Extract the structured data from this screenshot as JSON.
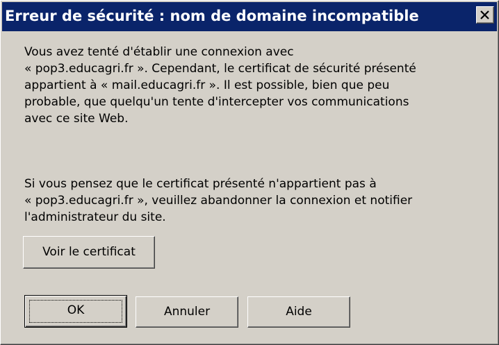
{
  "window": {
    "title": "Erreur de sécurité : nom de domaine incompatible",
    "close_icon": "close-icon"
  },
  "message": {
    "paragraph1": [
      "Vous avez tenté d'établir une connexion avec",
      "« pop3.educagri.fr ». Cependant, le certificat de sécurité présenté",
      "appartient à « mail.educagri.fr ». Il est possible, bien que peu",
      "probable, que quelqu'un tente d'intercepter vos communications",
      "avec ce site Web."
    ],
    "paragraph2": [
      "Si vous pensez que le certificat présenté n'appartient pas à",
      "« pop3.educagri.fr », veuillez abandonner la connexion et notifier",
      "l'administrateur du site."
    ]
  },
  "buttons": {
    "view_certificate": "Voir le certificat",
    "ok": "OK",
    "cancel": "Annuler",
    "help": "Aide"
  },
  "colors": {
    "titlebar": "#0a246a",
    "face": "#d4d0c8"
  }
}
